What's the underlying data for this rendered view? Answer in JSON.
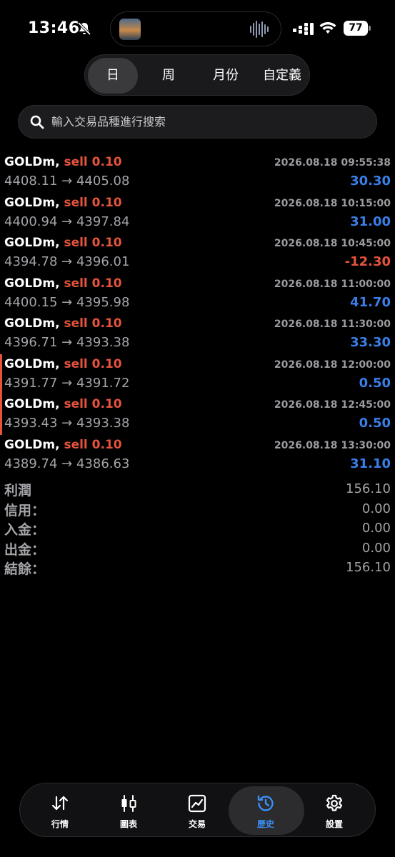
{
  "status_bar": {
    "time": "13:46",
    "battery": "77"
  },
  "period_tabs": [
    {
      "label": "日",
      "active": true
    },
    {
      "label": "周",
      "active": false
    },
    {
      "label": "月份",
      "active": false
    },
    {
      "label": "自定義",
      "active": false
    }
  ],
  "search": {
    "placeholder": "輸入交易品種進行搜索"
  },
  "trades": [
    {
      "symbol": "GOLDm,",
      "side": "sell 0.10",
      "time": "2026.08.18 09:55:38",
      "prices": "4408.11 → 4405.08",
      "profit": "30.30",
      "sign": "pos"
    },
    {
      "symbol": "GOLDm,",
      "side": "sell 0.10",
      "time": "2026.08.18 10:15:00",
      "prices": "4400.94 → 4397.84",
      "profit": "31.00",
      "sign": "pos"
    },
    {
      "symbol": "GOLDm,",
      "side": "sell 0.10",
      "time": "2026.08.18 10:45:00",
      "prices": "4394.78 → 4396.01",
      "profit": "-12.30",
      "sign": "neg"
    },
    {
      "symbol": "GOLDm,",
      "side": "sell 0.10",
      "time": "2026.08.18 11:00:00",
      "prices": "4400.15 → 4395.98",
      "profit": "41.70",
      "sign": "pos"
    },
    {
      "symbol": "GOLDm,",
      "side": "sell 0.10",
      "time": "2026.08.18 11:30:00",
      "prices": "4396.71 → 4393.38",
      "profit": "33.30",
      "sign": "pos"
    },
    {
      "symbol": "GOLDm,",
      "side": "sell 0.10",
      "time": "2026.08.18 12:00:00",
      "prices": "4391.77 → 4391.72",
      "profit": "0.50",
      "sign": "pos"
    },
    {
      "symbol": "GOLDm,",
      "side": "sell 0.10",
      "time": "2026.08.18 12:45:00",
      "prices": "4393.43 → 4393.38",
      "profit": "0.50",
      "sign": "pos"
    },
    {
      "symbol": "GOLDm,",
      "side": "sell 0.10",
      "time": "2026.08.18 13:30:00",
      "prices": "4389.74 → 4386.63",
      "profit": "31.10",
      "sign": "pos"
    }
  ],
  "summary": [
    {
      "label": "利潤",
      "value": "156.10"
    },
    {
      "label": "信用：",
      "value": "0.00"
    },
    {
      "label": "入金：",
      "value": "0.00"
    },
    {
      "label": "出金：",
      "value": "0.00"
    },
    {
      "label": "結餘：",
      "value": "156.10"
    }
  ],
  "tabbar": [
    {
      "label": "行情",
      "icon": "quotes-arrows-icon",
      "active": false
    },
    {
      "label": "圖表",
      "icon": "candlestick-chart-icon",
      "active": false
    },
    {
      "label": "交易",
      "icon": "trade-chart-icon",
      "active": false
    },
    {
      "label": "歷史",
      "icon": "history-clock-icon",
      "active": true
    },
    {
      "label": "設置",
      "icon": "settings-gear-icon",
      "active": false
    }
  ],
  "colors": {
    "sell": "#e5533d",
    "profit_positive": "#3a7ee8",
    "profit_negative": "#e5533d",
    "active_tab": "#3a8ff5",
    "marker": "#e5533d"
  }
}
